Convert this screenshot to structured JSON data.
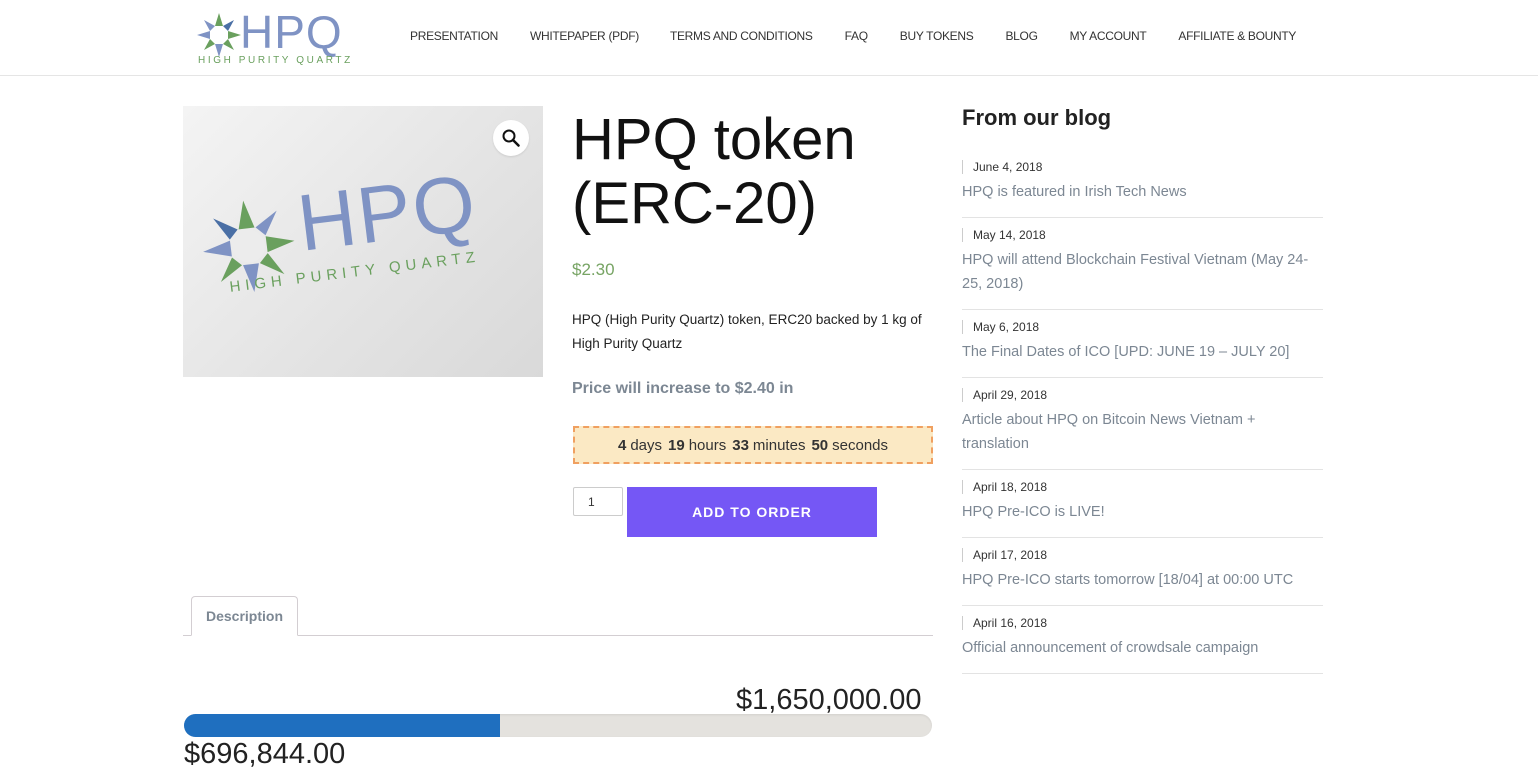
{
  "brand": {
    "logo_text": "HPQ",
    "logo_subtitle": "HIGH PURITY QUARTZ"
  },
  "nav": [
    {
      "label": "PRESENTATION"
    },
    {
      "label": "WHITEPAPER (PDF)"
    },
    {
      "label": "TERMS AND CONDITIONS"
    },
    {
      "label": "FAQ"
    },
    {
      "label": "BUY TOKENS"
    },
    {
      "label": "BLOG"
    },
    {
      "label": "MY ACCOUNT"
    },
    {
      "label": "AFFILIATE & BOUNTY"
    }
  ],
  "product": {
    "image_logo_text": "HPQ",
    "image_logo_subtitle": "HIGH PURITY QUARTZ",
    "zoom_icon": "magnifier-icon",
    "title": "HPQ token (ERC-20)",
    "price": "$2.30",
    "description": "HPQ (High Purity Quartz) token, ERC20 backed by 1 kg of High Purity Quartz",
    "price_increase": "Price will increase to $2.40 in",
    "countdown": {
      "days": "4",
      "days_label": "days",
      "hours": "19",
      "hours_label": "hours",
      "minutes": "33",
      "minutes_label": "minutes",
      "seconds": "50",
      "seconds_label": "seconds"
    },
    "quantity": "1",
    "add_button": "ADD TO ORDER"
  },
  "tabs": [
    {
      "label": "Description"
    }
  ],
  "funding": {
    "goal": "$1,650,000.00",
    "raised": "$696,844.00",
    "progress_fraction": 0.4223
  },
  "sidebar": {
    "title": "From our blog",
    "posts": [
      {
        "date": "June 4, 2018",
        "title": "HPQ is featured in Irish Tech News"
      },
      {
        "date": "May 14, 2018",
        "title": "HPQ will attend Blockchain Festival Vietnam (May 24-25, 2018)"
      },
      {
        "date": "May 6, 2018",
        "title": "The Final Dates of ICO [UPD: JUNE 19 – JULY 20]"
      },
      {
        "date": "April 29, 2018",
        "title": "Article about HPQ on Bitcoin News Vietnam + translation"
      },
      {
        "date": "April 18, 2018",
        "title": "HPQ Pre-ICO is LIVE!"
      },
      {
        "date": "April 17, 2018",
        "title": "HPQ Pre-ICO starts tomorrow [18/04] at 00:00 UTC"
      },
      {
        "date": "April 16, 2018",
        "title": "Official announcement of crowdsale campaign"
      }
    ]
  },
  "colors": {
    "accent_button": "#7557f5",
    "price_green": "#77a464",
    "progress_blue": "#1f6fbf",
    "logo_blue": "#7f93c4",
    "logo_green": "#6aa05e"
  }
}
